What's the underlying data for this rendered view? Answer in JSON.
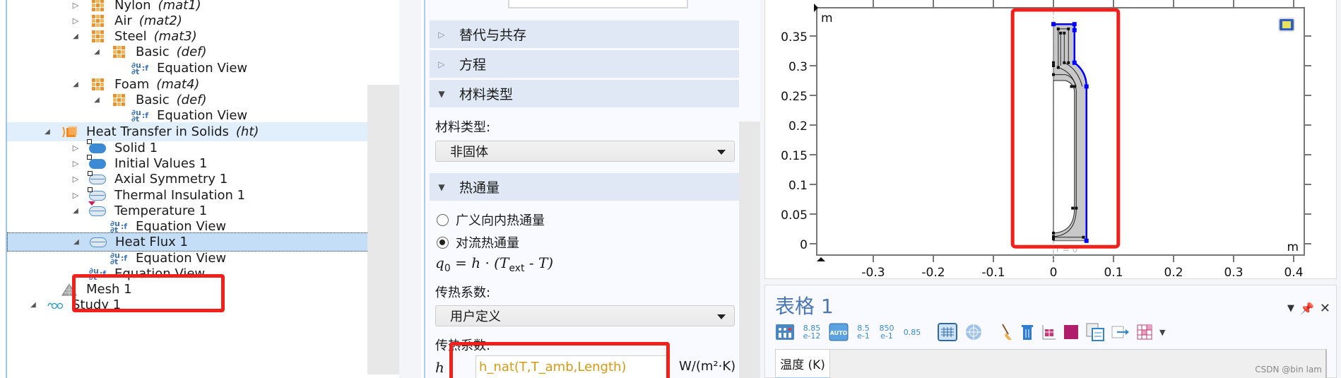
{
  "tree": {
    "items": [
      {
        "label": "Nylon",
        "tag": "(mat1)",
        "icon": "material-icon",
        "toggle": "collapsed",
        "level": 4
      },
      {
        "label": "Air",
        "tag": "(mat2)",
        "icon": "material-icon",
        "toggle": "collapsed",
        "level": 4
      },
      {
        "label": "Steel",
        "tag": "(mat3)",
        "icon": "material-icon",
        "toggle": "expanded",
        "level": 4
      },
      {
        "label": "Basic",
        "tag": "(def)",
        "icon": "material-icon",
        "toggle": "expanded",
        "level": 5
      },
      {
        "label": "Equation View",
        "tag": "",
        "icon": "equation-view-icon",
        "toggle": "none",
        "level": 6
      },
      {
        "label": "Foam",
        "tag": "(mat4)",
        "icon": "material-icon",
        "toggle": "expanded",
        "level": 4
      },
      {
        "label": "Basic",
        "tag": "(def)",
        "icon": "material-icon",
        "toggle": "expanded",
        "level": 5
      },
      {
        "label": "Equation View",
        "tag": "",
        "icon": "equation-view-icon",
        "toggle": "none",
        "level": 6
      },
      {
        "label": "Heat Transfer in Solids",
        "tag": "(ht)",
        "icon": "heat-transfer-physics-icon",
        "toggle": "expanded",
        "level": 3,
        "highlight": true
      },
      {
        "label": "Solid 1",
        "tag": "",
        "icon": "domain-node-icon",
        "toggle": "collapsed",
        "level": 4
      },
      {
        "label": "Initial Values 1",
        "tag": "",
        "icon": "domain-node-icon",
        "toggle": "collapsed",
        "level": 4
      },
      {
        "label": "Axial Symmetry 1",
        "tag": "",
        "icon": "boundary-node-icon",
        "toggle": "collapsed",
        "level": 4
      },
      {
        "label": "Thermal Insulation 1",
        "tag": "",
        "icon": "boundary-default-node-icon",
        "toggle": "collapsed",
        "level": 4
      },
      {
        "label": "Temperature 1",
        "tag": "",
        "icon": "boundary-icon",
        "toggle": "expanded",
        "level": 4
      },
      {
        "label": "Equation View",
        "tag": "",
        "icon": "equation-view-icon",
        "toggle": "none",
        "level": 5
      },
      {
        "label": "Heat Flux 1",
        "tag": "",
        "icon": "boundary-icon",
        "toggle": "expanded",
        "level": 4,
        "selected": true
      },
      {
        "label": "Equation View",
        "tag": "",
        "icon": "equation-view-icon",
        "toggle": "none",
        "level": 5
      },
      {
        "label": "Equation View",
        "tag": "",
        "icon": "equation-view-icon",
        "toggle": "none",
        "level": 4
      },
      {
        "label": "Mesh 1",
        "tag": "",
        "icon": "mesh-icon",
        "toggle": "none",
        "level": 3
      },
      {
        "label": "Study 1",
        "tag": "",
        "icon": "study-icon",
        "toggle": "expanded",
        "level": 2
      }
    ]
  },
  "settings": {
    "sections": {
      "override": "替代与共存",
      "equation": "方程",
      "material_type": "材料类型",
      "heat_flux": "热通量"
    },
    "material_type_label": "材料类型:",
    "material_type_value": "非固体",
    "radio_options": [
      {
        "label": "广义向内热通量",
        "checked": false
      },
      {
        "label": "对流热通量",
        "checked": true
      }
    ],
    "formula": {
      "lhs": "q",
      "lhs_sub": "0",
      "rhs_a": "= h · (T",
      "rhs_sub": "ext",
      "rhs_b": " - T)"
    },
    "htc_label": "传热系数:",
    "htc_type_value": "用户定义",
    "htc_label2": "传热系数:",
    "h_symbol": "h",
    "h_value": "h_nat(T,T_amb,Length)",
    "h_unit": "W/(m²·K)"
  },
  "graphics": {
    "x_unit": "m",
    "y_unit": "m",
    "x_ticks": [
      "-0.3",
      "-0.2",
      "-0.1",
      "0",
      "0.1",
      "0.2",
      "0.3",
      "0.4"
    ],
    "x_tick_values": [
      -0.3,
      -0.2,
      -0.1,
      0,
      0.1,
      0.2,
      0.3,
      0.4
    ],
    "y_ticks": [
      "0",
      "0.05",
      "0.1",
      "0.15",
      "0.2",
      "0.25",
      "0.3",
      "0.35"
    ],
    "y_tick_values": [
      0,
      0.05,
      0.1,
      0.15,
      0.2,
      0.25,
      0.3,
      0.35
    ],
    "axis_label_r0": "r = 0",
    "highlight_color": "#0000ff",
    "geometry_fill": "#c8c8c8"
  },
  "table_panel": {
    "title": "表格 1",
    "toolbar": [
      {
        "name": "table-settings-icon",
        "label": ""
      },
      {
        "name": "format-engineering-button",
        "label": "8.85\ne-12"
      },
      {
        "name": "format-auto-button",
        "label": "AUTO"
      },
      {
        "name": "format-scientific-button",
        "label": "8.5\ne-1"
      },
      {
        "name": "format-engineering2-button",
        "label": "850\ne-1"
      },
      {
        "name": "format-decimal-button",
        "label": "0.85"
      }
    ],
    "column_header": "温度 (K)",
    "watermark": "CSDN @bin lam"
  }
}
